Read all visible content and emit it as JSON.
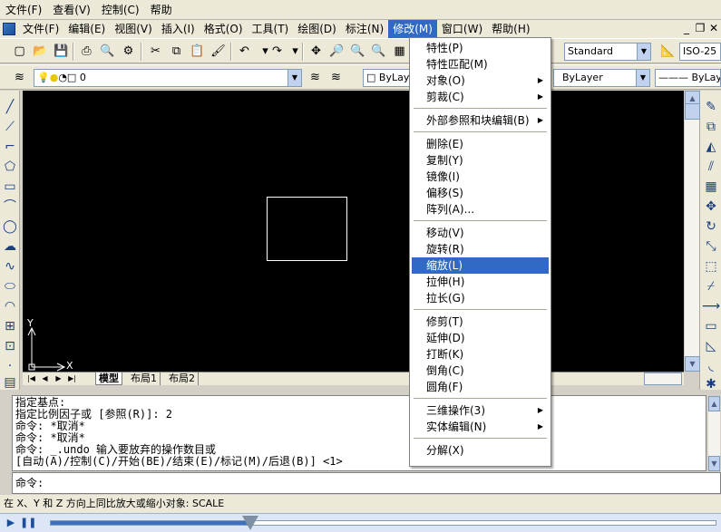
{
  "player_menu": [
    "文件(F)",
    "查看(V)",
    "控制(C)",
    "帮助"
  ],
  "app_menu": [
    "文件(F)",
    "编辑(E)",
    "视图(V)",
    "插入(I)",
    "格式(O)",
    "工具(T)",
    "绘图(D)",
    "标注(N)",
    "修改(M)",
    "窗口(W)",
    "帮助(H)"
  ],
  "active_menu": "修改(M)",
  "toolbar": {
    "text_style": "Standard",
    "dim_style": "ISO-25",
    "layer": "0",
    "color": "ByLayer",
    "linetype": "ByLayer",
    "lineweight": "ByLay"
  },
  "canvas": {
    "ucs_x": "X",
    "ucs_y": "Y"
  },
  "tabs": [
    "模型",
    "布局1",
    "布局2"
  ],
  "dropdown_groups": [
    [
      "特性(P)",
      "特性匹配(M)",
      "对象(O)",
      "剪裁(C)"
    ],
    [
      "外部参照和块编辑(B)"
    ],
    [
      "删除(E)",
      "复制(Y)",
      "镜像(I)",
      "偏移(S)",
      "阵列(A)..."
    ],
    [
      "移动(V)",
      "旋转(R)",
      "缩放(L)",
      "拉伸(H)",
      "拉长(G)"
    ],
    [
      "修剪(T)",
      "延伸(D)",
      "打断(K)",
      "倒角(C)",
      "圆角(F)"
    ],
    [
      "三维操作(3)",
      "实体编辑(N)"
    ],
    [
      "分解(X)"
    ]
  ],
  "dropdown_submenus": [
    "对象(O)",
    "剪裁(C)",
    "外部参照和块编辑(B)",
    "三维操作(3)",
    "实体编辑(N)"
  ],
  "highlighted_item": "缩放(L)",
  "command_history": [
    "指定基点:",
    "指定比例因子或 [参照(R)]: 2",
    "命令: *取消*",
    "命令: *取消*",
    "命令: _.undo 输入要放弃的操作数目或",
    "[自动(A)/控制(C)/开始(BE)/结束(E)/标记(M)/后退(B)] <1>"
  ],
  "command_prompt": "命令:",
  "status_text": "在 X、Y 和 Z 方向上同比放大或缩小对象:  SCALE",
  "playback_progress": 0.3
}
